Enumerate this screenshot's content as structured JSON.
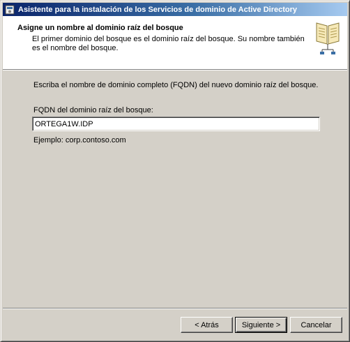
{
  "window": {
    "title": "Asistente para la instalación de los Servicios de dominio de Active Directory",
    "icon": "ad-wizard-icon"
  },
  "header": {
    "title": "Asigne un nombre al dominio raíz del bosque",
    "description": "El primer dominio del bosque es el dominio raíz del bosque. Su nombre también es el nombre del bosque.",
    "icon": "book-tree-icon"
  },
  "main": {
    "instruction": "Escriba el nombre de dominio completo (FQDN) del nuevo dominio raíz del bosque.",
    "fqdn_label": "FQDN del dominio raíz del bosque:",
    "fqdn_value": "ORTEGA1W.IDP",
    "example": "Ejemplo: corp.contoso.com"
  },
  "buttons": {
    "back": "< Atrás",
    "next": "Siguiente >",
    "cancel": "Cancelar"
  }
}
